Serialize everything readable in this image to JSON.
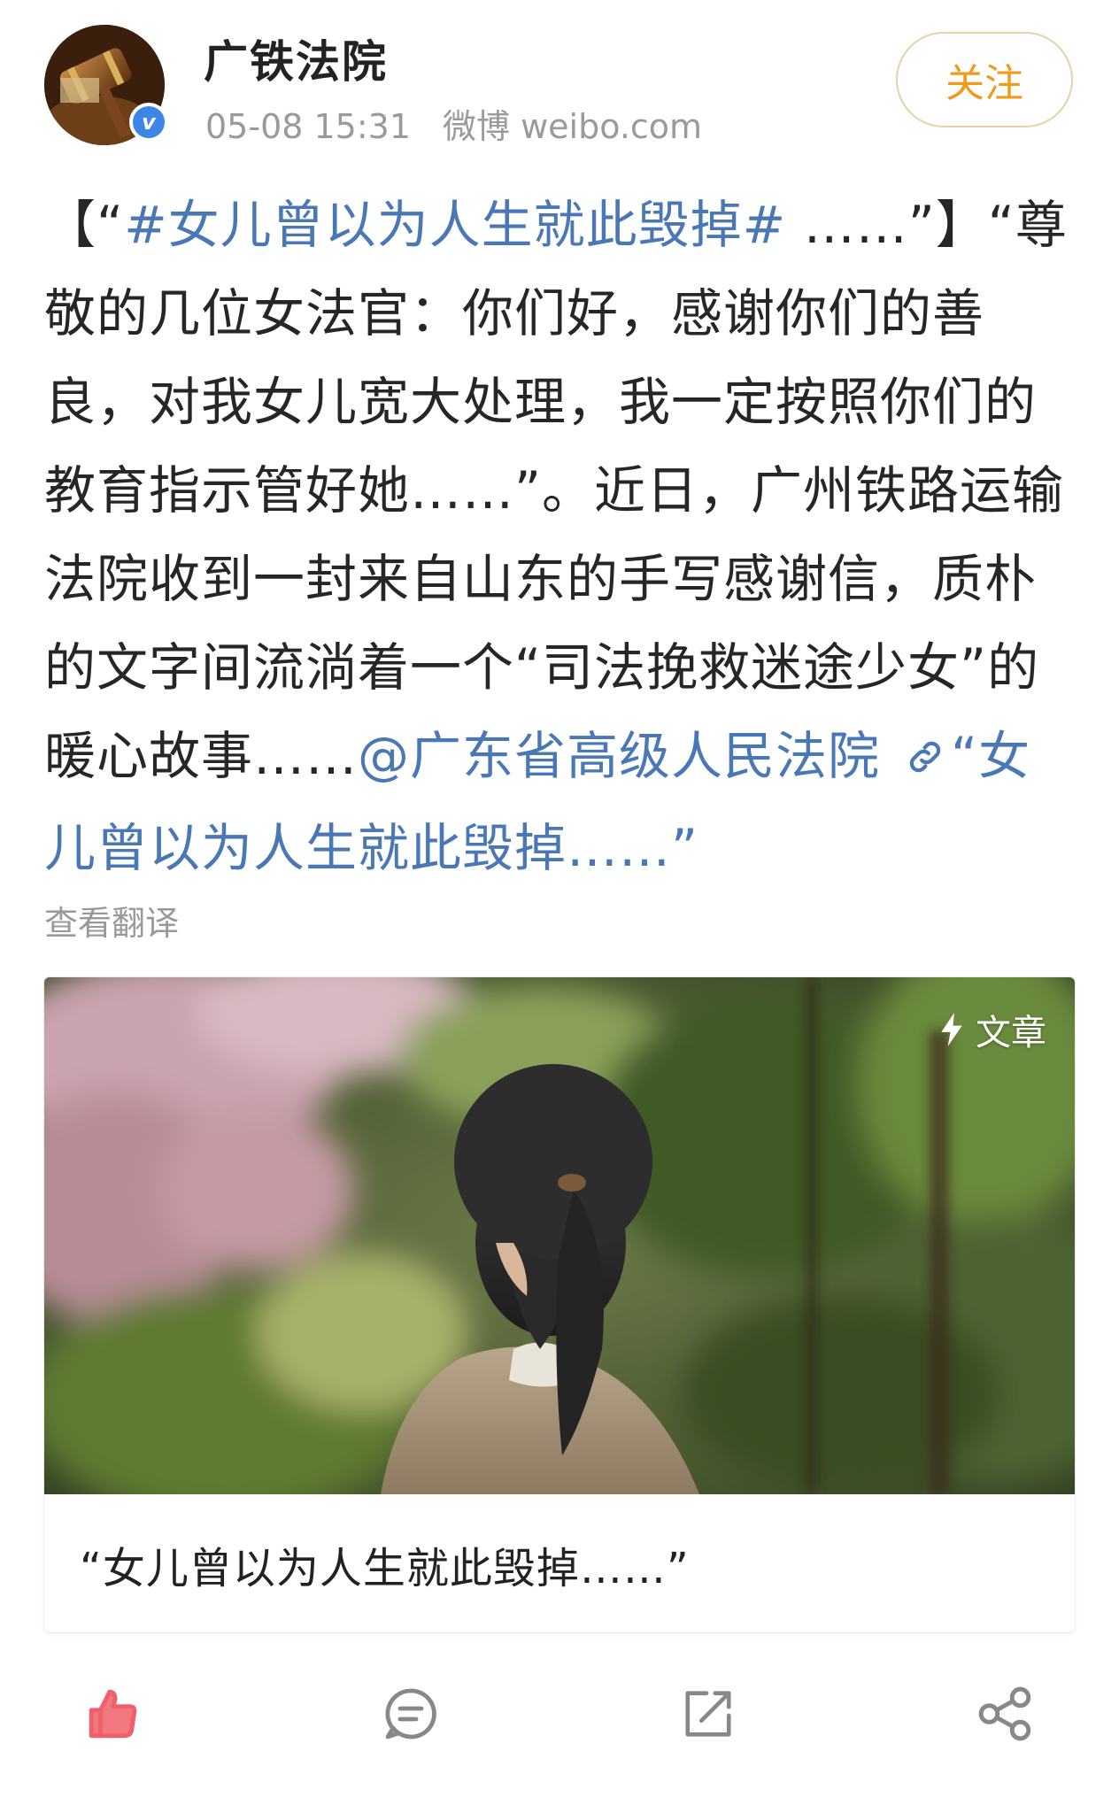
{
  "post": {
    "author": "广铁法院",
    "verified": true,
    "time": "05-08 15:31",
    "source": "微博 weibo.com",
    "follow_label": "关注",
    "text": {
      "open_bracket": "【",
      "open_quote": "“",
      "hashtag": "#女儿曾以为人生就此毁掉#",
      "ellipsis_close": " ……”】",
      "body": "“尊敬的几位女法官：你们好，感谢你们的善良，对我女儿宽大处理，我一定按照你们的教育指示管好她……”。近日，广州铁路运输法院收到一封来自山东的手写感谢信，质朴的文字间流淌着一个“司法挽救迷途少女”的暖心故事……",
      "mention": "@广东省高级人民法院",
      "link_text": "“女儿曾以为人生就此毁掉……”"
    },
    "translate_label": "查看翻译"
  },
  "article_card": {
    "tag_icon": "bolt-icon",
    "tag": "文章",
    "title": "“女儿曾以为人生就此毁掉……”"
  },
  "actions": [
    {
      "name": "like",
      "icon": "thumbs-up-icon",
      "color": "#f0606a"
    },
    {
      "name": "comment",
      "icon": "comment-icon",
      "color": "#888888"
    },
    {
      "name": "repost",
      "icon": "share-icon",
      "color": "#888888"
    },
    {
      "name": "more-share",
      "icon": "network-share-icon",
      "color": "#888888"
    }
  ],
  "colors": {
    "link": "#4a77b5",
    "follow": "#f09a1a",
    "verified": "#3d86e6",
    "meta": "#9a9a9a"
  }
}
